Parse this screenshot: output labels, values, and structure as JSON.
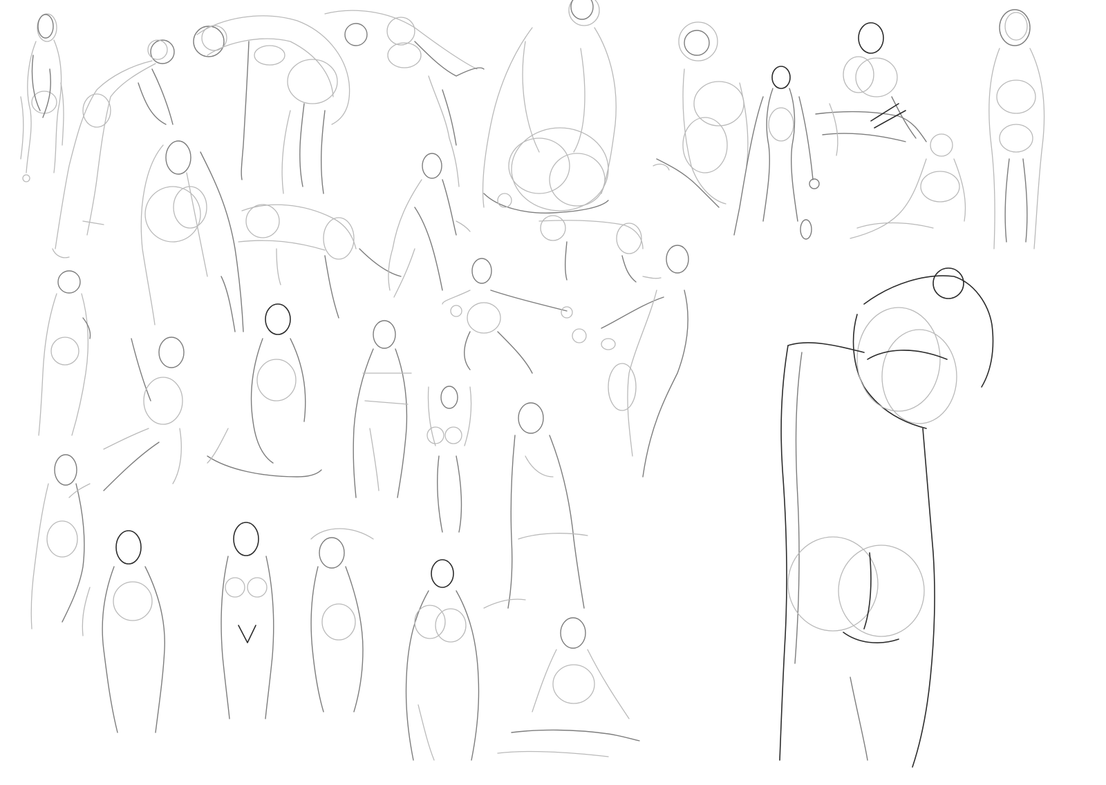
{
  "canvas": {
    "background": "#ffffff",
    "stroke_colors": {
      "light": "#b9b9b9",
      "mid": "#7c7c7c",
      "dark": "#2b2b2b"
    }
  },
  "figures": [
    {
      "id": "f01",
      "pose": "standing-back"
    },
    {
      "id": "f02",
      "pose": "bending-forward"
    },
    {
      "id": "f03",
      "pose": "bending-arch"
    },
    {
      "id": "f04",
      "pose": "reaching-arm"
    },
    {
      "id": "f05",
      "pose": "kneeling-back-large"
    },
    {
      "id": "f06",
      "pose": "crouching-side"
    },
    {
      "id": "f07",
      "pose": "standing-front-thin"
    },
    {
      "id": "f08",
      "pose": "crouching-cluster"
    },
    {
      "id": "f09",
      "pose": "reclining"
    },
    {
      "id": "f10",
      "pose": "standing-front"
    },
    {
      "id": "f11",
      "pose": "standing-hair-long"
    },
    {
      "id": "f12",
      "pose": "all-fours"
    },
    {
      "id": "f13",
      "pose": "lunging"
    },
    {
      "id": "f14",
      "pose": "all-fours-small"
    },
    {
      "id": "f15",
      "pose": "squatting-arms-out"
    },
    {
      "id": "f16",
      "pose": "leaning-reach"
    },
    {
      "id": "f17",
      "pose": "standing-back-small"
    },
    {
      "id": "f18",
      "pose": "sitting-arm-raised"
    },
    {
      "id": "f19",
      "pose": "kneeling"
    },
    {
      "id": "f20",
      "pose": "standing-robed"
    },
    {
      "id": "f21",
      "pose": "arms-up"
    },
    {
      "id": "f22",
      "pose": "standing-draped"
    },
    {
      "id": "f23",
      "pose": "crouching-small"
    },
    {
      "id": "f24",
      "pose": "twisting"
    },
    {
      "id": "f25",
      "pose": "standing-front-outline"
    },
    {
      "id": "f26",
      "pose": "arms-overhead"
    },
    {
      "id": "f27",
      "pose": "walking-cloak"
    },
    {
      "id": "f28",
      "pose": "seated-floor"
    },
    {
      "id": "f29",
      "pose": "large-back-arm-overhead"
    }
  ]
}
